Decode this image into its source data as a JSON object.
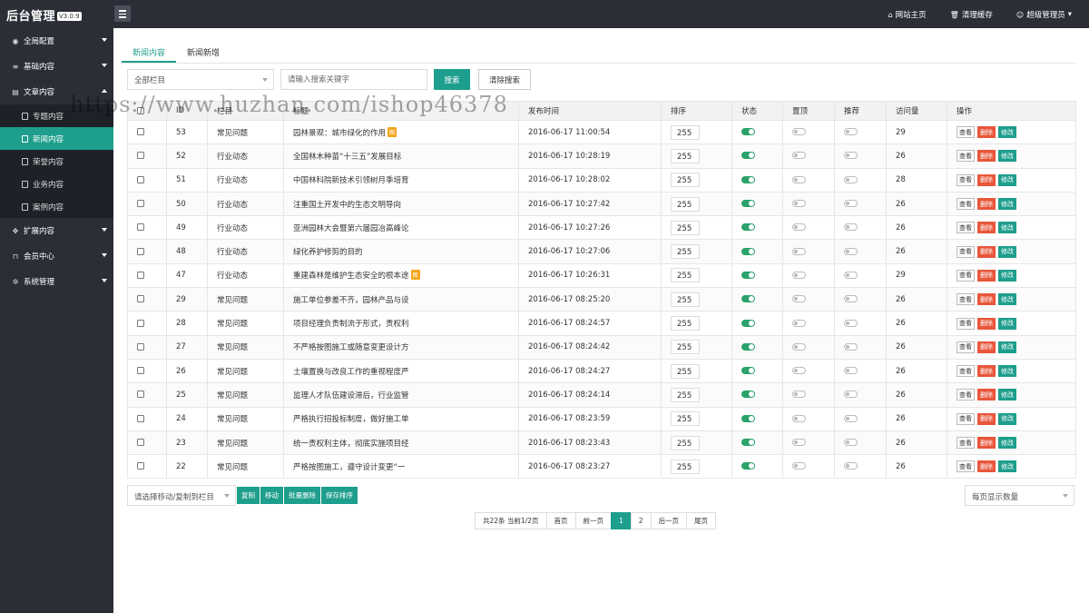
{
  "header": {
    "title": "后台管理",
    "version": "V3.0.9",
    "links": [
      {
        "icon": "home-icon",
        "glyph": "⌂",
        "label": "网站主页"
      },
      {
        "icon": "trash-icon",
        "glyph": "🗑",
        "label": "清理缓存"
      },
      {
        "icon": "user-icon",
        "glyph": "☺",
        "label": "超级管理员",
        "dropdown": true
      }
    ]
  },
  "sidebar": {
    "sections": [
      {
        "icon": "globe-icon",
        "glyph": "◉",
        "label": "全局配置",
        "expanded": false
      },
      {
        "icon": "sliders-icon",
        "glyph": "≡",
        "label": "基础内容",
        "expanded": false
      },
      {
        "icon": "document-icon",
        "glyph": "▤",
        "label": "文章内容",
        "expanded": true,
        "items": [
          {
            "label": "专题内容",
            "active": false
          },
          {
            "label": "新闻内容",
            "active": true
          },
          {
            "label": "荣誉内容",
            "active": false
          },
          {
            "label": "业务内容",
            "active": false
          },
          {
            "label": "案例内容",
            "active": false
          }
        ]
      },
      {
        "icon": "expand-icon",
        "glyph": "✥",
        "label": "扩展内容",
        "expanded": false
      },
      {
        "icon": "lock-icon",
        "glyph": "⊓",
        "label": "会员中心",
        "expanded": false
      },
      {
        "icon": "gear-icon",
        "glyph": "✲",
        "label": "系统管理",
        "expanded": false
      }
    ]
  },
  "tabs": [
    {
      "label": "新闻内容",
      "active": true
    },
    {
      "label": "新闻新增",
      "active": false
    }
  ],
  "filter": {
    "category_value": "全部栏目",
    "keyword_placeholder": "请输入搜索关键字",
    "search_label": "搜索",
    "clear_label": "清除搜索"
  },
  "table": {
    "columns": [
      "",
      "ID",
      "栏目",
      "标题",
      "发布时间",
      "排序",
      "状态",
      "置顶",
      "推荐",
      "访问量",
      "操作"
    ],
    "rows": [
      {
        "id": "53",
        "category": "常见问题",
        "title": "园林景观：城市绿化的作用",
        "tag": "图",
        "time": "2016-06-17 11:00:54",
        "sort": "255",
        "status": true,
        "top": false,
        "recommend": false,
        "views": "29"
      },
      {
        "id": "52",
        "category": "行业动态",
        "title": "全国林木种苗“十三五”发展目标",
        "tag": "",
        "time": "2016-06-17 10:28:19",
        "sort": "255",
        "status": true,
        "top": false,
        "recommend": false,
        "views": "26"
      },
      {
        "id": "51",
        "category": "行业动态",
        "title": "中国林科院新技术引领树月季培育",
        "tag": "",
        "time": "2016-06-17 10:28:02",
        "sort": "255",
        "status": true,
        "top": false,
        "recommend": false,
        "views": "28"
      },
      {
        "id": "50",
        "category": "行业动态",
        "title": "注重国土开发中的生态文明导向",
        "tag": "",
        "time": "2016-06-17 10:27:42",
        "sort": "255",
        "status": true,
        "top": false,
        "recommend": false,
        "views": "26"
      },
      {
        "id": "49",
        "category": "行业动态",
        "title": "亚洲园林大会暨第六届园冶高峰论",
        "tag": "",
        "time": "2016-06-17 10:27:26",
        "sort": "255",
        "status": true,
        "top": false,
        "recommend": false,
        "views": "26"
      },
      {
        "id": "48",
        "category": "行业动态",
        "title": "绿化养护修剪的目的",
        "tag": "",
        "time": "2016-06-17 10:27:06",
        "sort": "255",
        "status": true,
        "top": false,
        "recommend": false,
        "views": "26"
      },
      {
        "id": "47",
        "category": "行业动态",
        "title": "重建森林是维护生态安全的根本途",
        "tag": "图",
        "time": "2016-06-17 10:26:31",
        "sort": "255",
        "status": true,
        "top": false,
        "recommend": false,
        "views": "29"
      },
      {
        "id": "29",
        "category": "常见问题",
        "title": "施工单位参差不齐，园林产品与设",
        "tag": "",
        "time": "2016-06-17 08:25:20",
        "sort": "255",
        "status": true,
        "top": false,
        "recommend": false,
        "views": "26"
      },
      {
        "id": "28",
        "category": "常见问题",
        "title": "项目经理负责制流于形式，责权利",
        "tag": "",
        "time": "2016-06-17 08:24:57",
        "sort": "255",
        "status": true,
        "top": false,
        "recommend": false,
        "views": "26"
      },
      {
        "id": "27",
        "category": "常见问题",
        "title": "不严格按图施工或随意变更设计方",
        "tag": "",
        "time": "2016-06-17 08:24:42",
        "sort": "255",
        "status": true,
        "top": false,
        "recommend": false,
        "views": "26"
      },
      {
        "id": "26",
        "category": "常见问题",
        "title": "土壤置换与改良工作的重视程度严",
        "tag": "",
        "time": "2016-06-17 08:24:27",
        "sort": "255",
        "status": true,
        "top": false,
        "recommend": false,
        "views": "26"
      },
      {
        "id": "25",
        "category": "常见问题",
        "title": "监理人才队伍建设滞后，行业监管",
        "tag": "",
        "time": "2016-06-17 08:24:14",
        "sort": "255",
        "status": true,
        "top": false,
        "recommend": false,
        "views": "26"
      },
      {
        "id": "24",
        "category": "常见问题",
        "title": "严格执行招投标制度，做好施工单",
        "tag": "",
        "time": "2016-06-17 08:23:59",
        "sort": "255",
        "status": true,
        "top": false,
        "recommend": false,
        "views": "26"
      },
      {
        "id": "23",
        "category": "常见问题",
        "title": "统一责权利主体，彻底实施项目经",
        "tag": "",
        "time": "2016-06-17 08:23:43",
        "sort": "255",
        "status": true,
        "top": false,
        "recommend": false,
        "views": "26"
      },
      {
        "id": "22",
        "category": "常见问题",
        "title": "严格按图施工，遵守设计变更“一",
        "tag": "",
        "time": "2016-06-17 08:23:27",
        "sort": "255",
        "status": true,
        "top": false,
        "recommend": false,
        "views": "26"
      }
    ],
    "actions": {
      "view": "查看",
      "delete": "删除",
      "edit": "修改"
    }
  },
  "bulk": {
    "select_placeholder": "请选择移动/复制到栏目",
    "buttons": [
      "复制",
      "移动",
      "批量删除",
      "保存排序"
    ]
  },
  "perpage_label": "每页显示数量",
  "pagination": {
    "summary": "共22条 当前1/2页",
    "first": "首页",
    "prev": "前一页",
    "pages": [
      "1",
      "2"
    ],
    "current": "1",
    "next": "后一页",
    "last": "尾页"
  },
  "watermark": "https://www.huzhan.com/ishop46378"
}
